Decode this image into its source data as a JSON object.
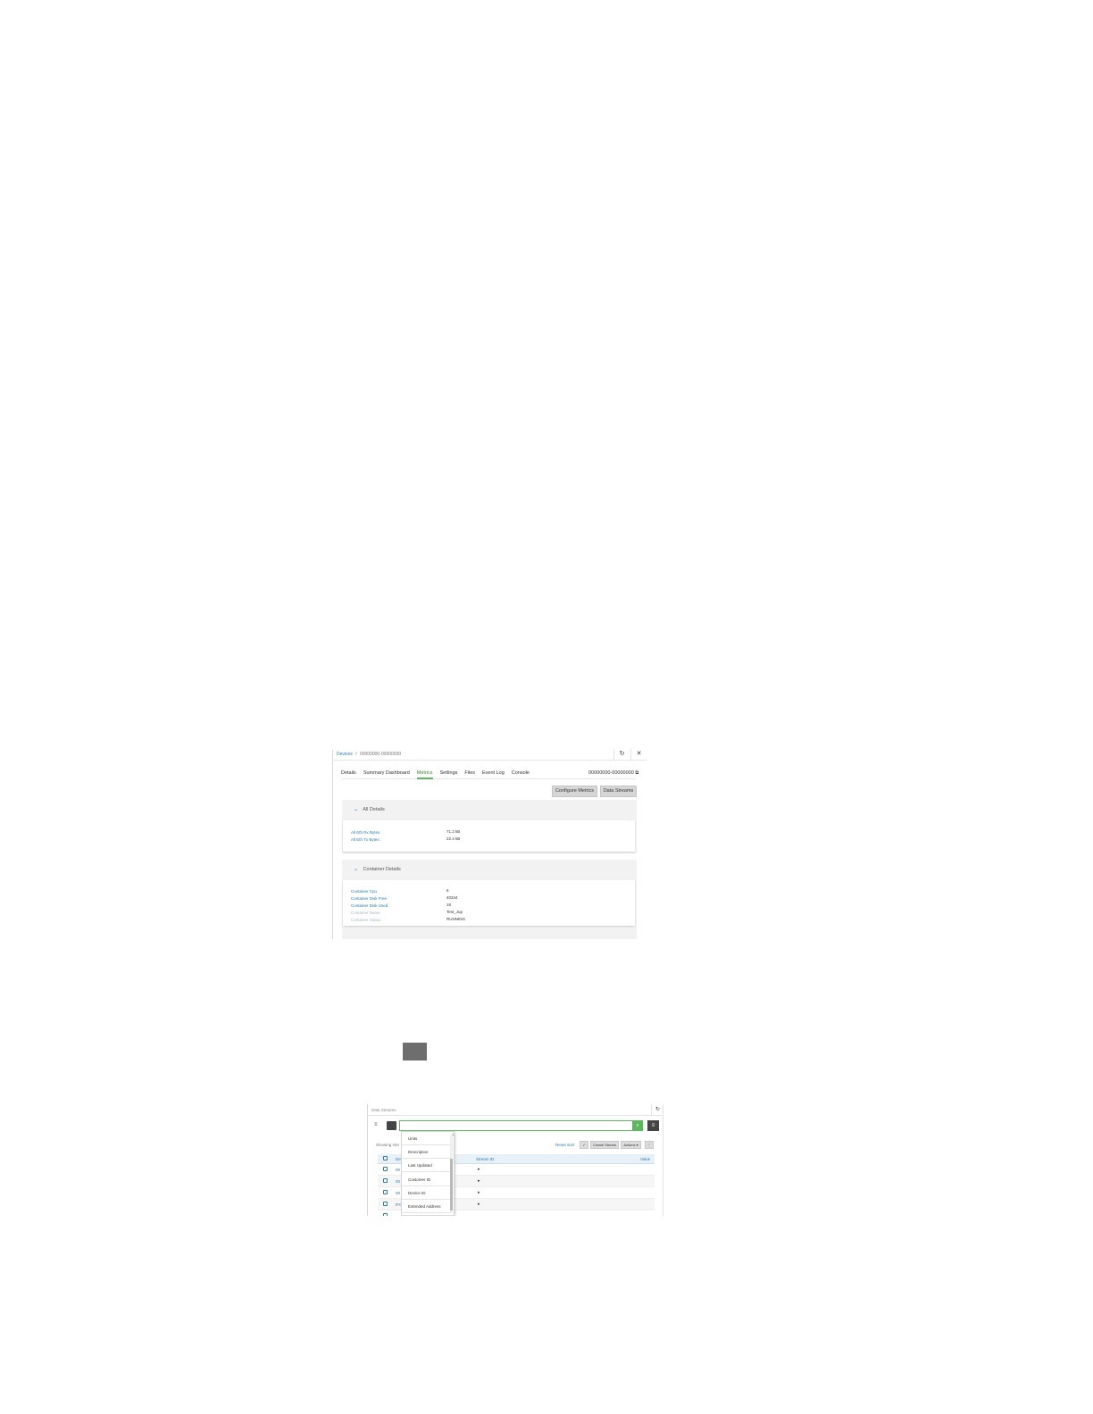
{
  "device_panel": {
    "breadcrumb": {
      "root": "Devices",
      "separator": "/",
      "current": "00000000-00000000"
    },
    "toolbar": {
      "refresh_icon": "refresh-icon",
      "close_icon": "close-icon"
    },
    "tabs": [
      {
        "label": "Details",
        "active": false
      },
      {
        "label": "Summary Dashboard",
        "active": false
      },
      {
        "label": "Metrics",
        "active": true
      },
      {
        "label": "Settings",
        "active": false
      },
      {
        "label": "Files",
        "active": false
      },
      {
        "label": "Event Log",
        "active": false
      },
      {
        "label": "Console",
        "active": false
      }
    ],
    "device_id": "00000000-00000000",
    "buttons": {
      "configure_metrics": "Configure Metrics",
      "data_streams": "Data Streams"
    },
    "sections": [
      {
        "title": "All Details",
        "rows": [
          {
            "key": "All Eth Rx Bytes",
            "value": "71.2 kB"
          },
          {
            "key": "All Eth Tx Bytes",
            "value": "22.4 kB"
          }
        ]
      },
      {
        "title": "Container Details",
        "rows": [
          {
            "key": "Container Cpu",
            "value": "6"
          },
          {
            "key": "Container Disk Free",
            "value": "40344"
          },
          {
            "key": "Container Disk Used",
            "value": "18"
          },
          {
            "key": "Container Name",
            "value": "Test_Jup"
          },
          {
            "key": "Container Status",
            "value": "RUNNING"
          }
        ]
      }
    ]
  },
  "data_streams_panel": {
    "title": "Data Streams",
    "showing_text": "Showing stre",
    "reset_sort": "Reset Sort",
    "buttons": {
      "check": "✓",
      "create_stream": "Create Stream",
      "actions": "Actions ▾",
      "more": "⋮"
    },
    "columns": {
      "first": "Dev",
      "stream_id": "Stream ID",
      "value": "Value"
    },
    "rows": [
      {
        "id": "00"
      },
      {
        "id": "00"
      },
      {
        "id": "00"
      },
      {
        "id": "IFC"
      }
    ],
    "column_menu": [
      "Units",
      "Description",
      "Last Updated",
      "Customer ID",
      "Device ID",
      "Extended Address"
    ]
  }
}
